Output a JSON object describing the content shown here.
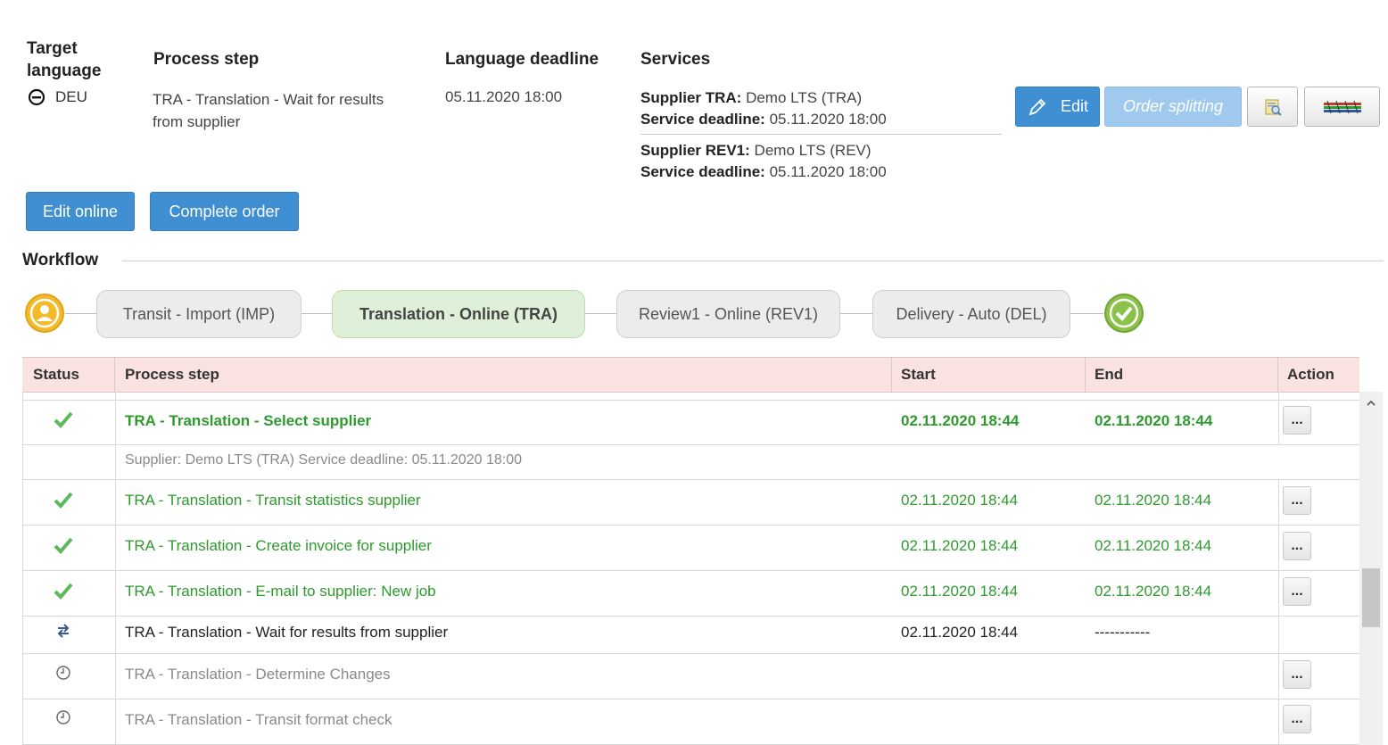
{
  "header": {
    "target_language_label": "Target\nlanguage",
    "process_step_label": "Process step",
    "deadline_label": "Language deadline",
    "services_label": "Services",
    "language": "DEU",
    "process_step_value_1": "TRA - Translation - Wait for results",
    "process_step_value_2": "from supplier",
    "deadline_value": "05.11.2020 18:00"
  },
  "services": [
    {
      "supplier_label": "Supplier TRA:",
      "supplier_value": "Demo LTS (TRA)",
      "deadline_label": "Service deadline:",
      "deadline_value": "05.11.2020 18:00"
    },
    {
      "supplier_label": "Supplier REV1:",
      "supplier_value": "Demo LTS (REV)",
      "deadline_label": "Service deadline:",
      "deadline_value": "05.11.2020 18:00"
    }
  ],
  "buttons": {
    "edit": "Edit",
    "order_splitting": "Order splitting",
    "edit_online": "Edit online",
    "complete_order": "Complete order"
  },
  "workflow": {
    "title": "Workflow",
    "steps": [
      "Transit - Import (IMP)",
      "Translation - Online (TRA)",
      "Review1 - Online (REV1)",
      "Delivery - Auto (DEL)"
    ]
  },
  "table": {
    "columns": [
      "Status",
      "Process step",
      "Start",
      "End",
      "Action"
    ],
    "rows": [
      {
        "step": "TRA - Translation - Select supplier",
        "start": "02.11.2020 18:44",
        "end": "02.11.2020 18:44",
        "status": "done"
      },
      {
        "detail": "Supplier: Demo LTS (TRA) Service deadline: 05.11.2020 18:00"
      },
      {
        "step": "TRA - Translation - Transit statistics supplier",
        "start": "02.11.2020 18:44",
        "end": "02.11.2020 18:44",
        "status": "done"
      },
      {
        "step": "TRA - Translation - Create invoice for supplier",
        "start": "02.11.2020 18:44",
        "end": "02.11.2020 18:44",
        "status": "done"
      },
      {
        "step": "TRA - Translation - E-mail to supplier: New job",
        "start": "02.11.2020 18:44",
        "end": "02.11.2020 18:44",
        "status": "done"
      },
      {
        "step": "TRA - Translation - Wait for results from supplier",
        "start": "02.11.2020 18:44",
        "end": "-----------",
        "status": "running"
      },
      {
        "step": "TRA - Translation - Determine Changes",
        "start": "",
        "end": "",
        "status": "pending"
      },
      {
        "step": "TRA - Translation - Transit format check",
        "start": "",
        "end": "",
        "status": "pending"
      }
    ],
    "action_label": "..."
  }
}
